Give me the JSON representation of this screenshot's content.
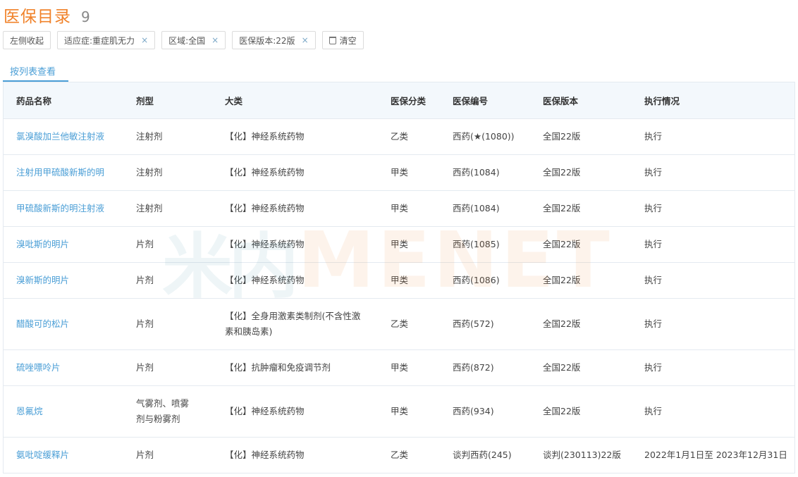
{
  "header": {
    "title": "医保目录",
    "count": "9"
  },
  "filters": {
    "collapse_label": "左侧收起",
    "tags": [
      {
        "label": "适应症:重症肌无力"
      },
      {
        "label": "区域:全国"
      },
      {
        "label": "医保版本:22版"
      }
    ],
    "close_glyph": "×",
    "clear_label": "清空"
  },
  "tabs": {
    "list_view": "按列表查看"
  },
  "watermark": {
    "cn": "米内",
    "en": "MENET"
  },
  "table": {
    "headers": [
      "药品名称",
      "剂型",
      "大类",
      "医保分类",
      "医保编号",
      "医保版本",
      "执行情况"
    ],
    "rows": [
      [
        "氯溴酸加兰他敏注射液",
        "注射剂",
        "【化】神经系统药物",
        "乙类",
        "西药(★(1080))",
        "全国22版",
        "执行"
      ],
      [
        "注射用甲硫酸新斯的明",
        "注射剂",
        "【化】神经系统药物",
        "甲类",
        "西药(1084)",
        "全国22版",
        "执行"
      ],
      [
        "甲硫酸新斯的明注射液",
        "注射剂",
        "【化】神经系统药物",
        "甲类",
        "西药(1084)",
        "全国22版",
        "执行"
      ],
      [
        "溴吡斯的明片",
        "片剂",
        "【化】神经系统药物",
        "甲类",
        "西药(1085)",
        "全国22版",
        "执行"
      ],
      [
        "溴新斯的明片",
        "片剂",
        "【化】神经系统药物",
        "甲类",
        "西药(1086)",
        "全国22版",
        "执行"
      ],
      [
        "醋酸可的松片",
        "片剂",
        "【化】全身用激素类制剂(不含性激素和胰岛素)",
        "乙类",
        "西药(572)",
        "全国22版",
        "执行"
      ],
      [
        "硫唑嘌呤片",
        "片剂",
        "【化】抗肿瘤和免疫调节剂",
        "甲类",
        "西药(872)",
        "全国22版",
        "执行"
      ],
      [
        "恩氟烷",
        "气雾剂、喷雾剂与粉雾剂",
        "【化】神经系统药物",
        "甲类",
        "西药(934)",
        "全国22版",
        "执行"
      ],
      [
        "氨吡啶缓释片",
        "片剂",
        "【化】神经系统药物",
        "乙类",
        "谈判西药(245)",
        "谈判(230113)22版",
        "2022年1月1日至 2023年12月31日"
      ]
    ]
  }
}
